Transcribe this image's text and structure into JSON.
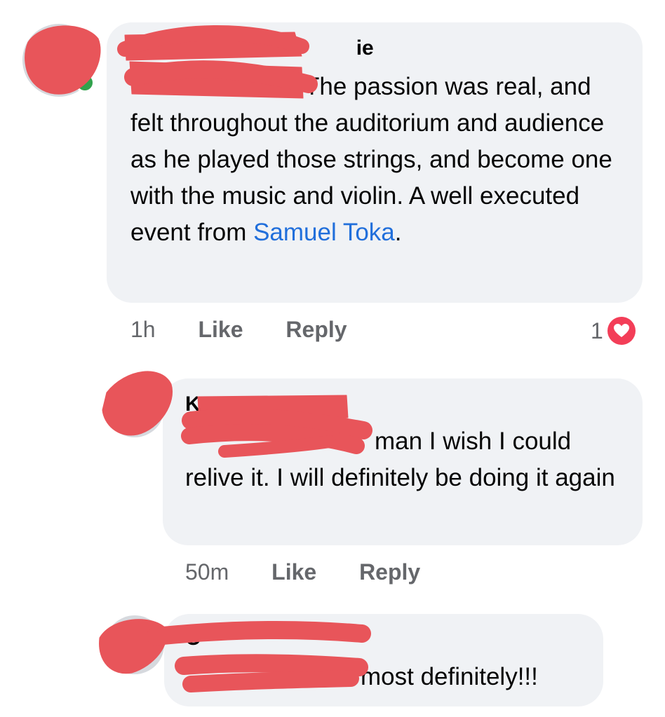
{
  "comments": [
    {
      "text_after_mention": "The passion was real, and felt throughout the auditorium and audience as he    played those strings, and become one with the music and violin. A well executed event from ",
      "tag": "Samuel Toka",
      "text_end": ".",
      "time": "1h",
      "like_label": "Like",
      "reply_label": "Reply",
      "reaction_count": "1",
      "reaction_icon": "heart-icon"
    },
    {
      "text_after_mention": "man I wish I could relive it. I will definitely be doing it again",
      "time": "50m",
      "like_label": "Like",
      "reply_label": "Reply"
    },
    {
      "text_after_mention": "most definitely!!!"
    }
  ],
  "colors": {
    "bubble": "#f0f2f5",
    "mention": "#216fdb",
    "redaction": "#e8555a",
    "online": "#31a24c",
    "heart": "#f33e58"
  }
}
